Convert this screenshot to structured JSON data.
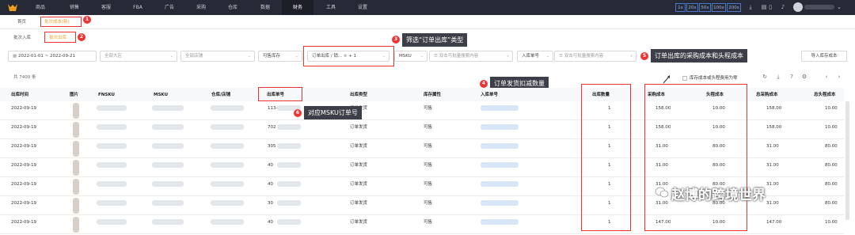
{
  "nav": {
    "items": [
      "商品",
      "销售",
      "客服",
      "FBA",
      "广告",
      "采购",
      "仓库",
      "数据",
      "财务",
      "工具",
      "设置"
    ],
    "zoom": [
      "1x",
      "20x",
      "50x",
      "100x",
      "200x"
    ]
  },
  "tabs": {
    "home": "首页",
    "active": "批次成本(新)",
    "sub1": "批次入库",
    "sub2": "批次出库"
  },
  "filters": {
    "date": "2022-01-01 ~ 2022-09-21",
    "region": "全部大区",
    "store": "全部店铺",
    "stock": "可售库存",
    "type": "订单出库 / 销...",
    "type_count": "+ 1",
    "sku_type": "MSKU",
    "sku_ph": "双击可批量搜索内容",
    "order_type": "入库单号",
    "order_ph": "双击可批量搜索内容",
    "import_btn": "导入库存成本"
  },
  "summary": {
    "count": "共 7400 条",
    "zero_label": "库存成本或头程费用为零"
  },
  "columns": [
    "出库时间",
    "图片",
    "FNSKU",
    "MSKU",
    "仓库/店铺",
    "出库单号",
    "出库类型",
    "库存属性",
    "入库单号",
    "出库数量",
    "采购成本",
    "头程成本",
    "总采购成本",
    "总头程成本"
  ],
  "rows": [
    {
      "date": "2022-09-19",
      "order": "113-",
      "type": "订单发货",
      "attr": "可售",
      "qty": "1",
      "purchase": "158.00",
      "freight": "10.00",
      "total_purchase": "158.00",
      "total_freight": "10.00"
    },
    {
      "date": "2022-09-19",
      "order": "702",
      "type": "订单发货",
      "attr": "可售",
      "qty": "1",
      "purchase": "158.00",
      "freight": "10.00",
      "total_purchase": "158.00",
      "total_freight": "10.00"
    },
    {
      "date": "2022-09-19",
      "order": "305",
      "type": "订单发货",
      "attr": "可售",
      "qty": "1",
      "purchase": "31.00",
      "freight": "80.00",
      "total_purchase": "31.00",
      "total_freight": "80.00"
    },
    {
      "date": "2022-09-19",
      "order": "40",
      "type": "订单发货",
      "attr": "可售",
      "qty": "1",
      "purchase": "31.00",
      "freight": "80.00",
      "total_purchase": "31.00",
      "total_freight": "80.00"
    },
    {
      "date": "2022-09-19",
      "order": "40",
      "type": "订单发货",
      "attr": "可售",
      "qty": "1",
      "purchase": "31.00",
      "freight": "80.00",
      "total_purchase": "31.00",
      "total_freight": "80.00"
    },
    {
      "date": "2022-09-19",
      "order": "30",
      "type": "订单发货",
      "attr": "可售",
      "qty": "1",
      "purchase": "31.00",
      "freight": "80.00",
      "total_purchase": "31.00",
      "total_freight": "80.00"
    },
    {
      "date": "2022-09-19",
      "order": "40",
      "type": "订单发货",
      "attr": "可售",
      "qty": "1",
      "purchase": "147.00",
      "freight": "10.00",
      "total_purchase": "147.00",
      "total_freight": "10.00"
    }
  ],
  "annotations": {
    "c1": "1",
    "c2": "2",
    "c3": "3",
    "c4": "4",
    "c5": "5",
    "c6": "6",
    "t3": "筛选“订单出库”类型",
    "t4": "订单发货扣减数量",
    "t5": "订单出库的采购成本和头程成本",
    "t6": "对应MSKU订单号"
  },
  "watermark": "赵博的跨境世界"
}
